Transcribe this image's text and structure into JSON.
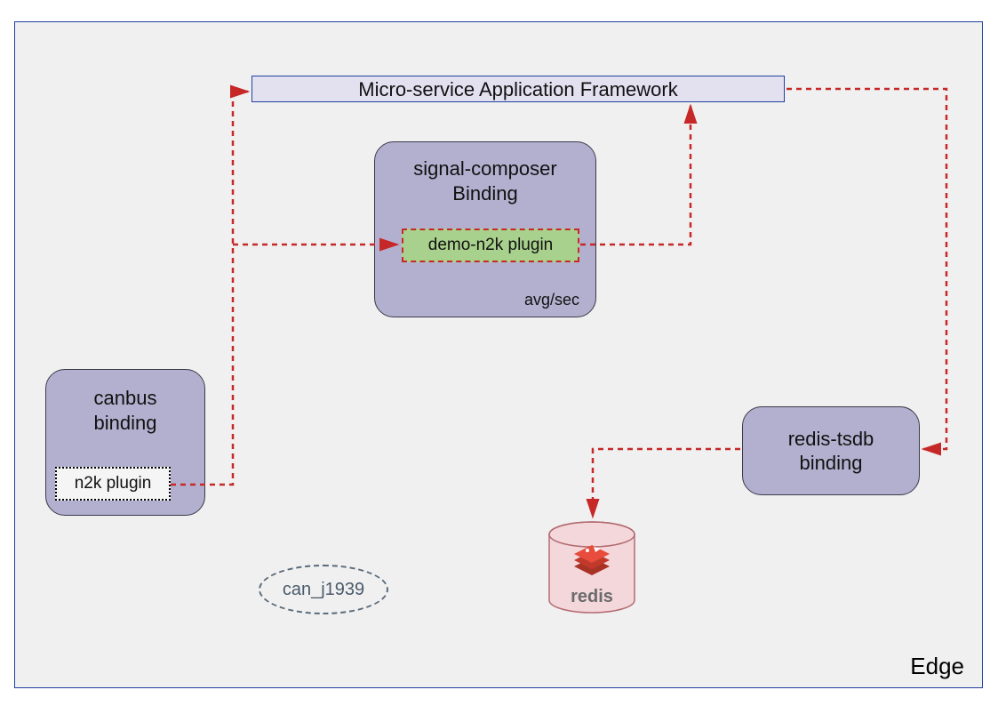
{
  "container": {
    "label": "Edge"
  },
  "framework": {
    "title": "Micro-service Application Framework"
  },
  "canbus": {
    "title_line1": "canbus",
    "title_line2": "binding",
    "plugin_label": "n2k plugin"
  },
  "signal_composer": {
    "title_line1": "signal-composer",
    "title_line2": "Binding",
    "plugin_label": "demo-n2k plugin",
    "footer": "avg/sec"
  },
  "redis_tsdb": {
    "title_line1": "redis-tsdb",
    "title_line2": "binding"
  },
  "can_j1939": {
    "label": "can_j1939"
  },
  "redis_cylinder": {
    "label": "redis"
  },
  "colors": {
    "arrow": "#c62828",
    "node_fill": "#b3b0cf",
    "node_stroke": "#3a3a4a",
    "framework_fill": "#e3e1f0",
    "framework_stroke": "#2040a0",
    "plugin_green": "#a9d18e",
    "cylinder_fill": "#f4d7da",
    "cylinder_stroke": "#b36b72"
  },
  "connections": [
    {
      "from": "canbus.n2k-plugin",
      "to": "framework",
      "style": "dashed-red"
    },
    {
      "from": "canbus.n2k-plugin",
      "to": "signal-composer.demo-plugin",
      "style": "dashed-red"
    },
    {
      "from": "signal-composer.demo-plugin",
      "to": "framework",
      "style": "dashed-red"
    },
    {
      "from": "framework",
      "to": "redis-tsdb",
      "style": "dashed-red"
    },
    {
      "from": "redis-tsdb",
      "to": "redis-cylinder",
      "style": "dashed-red"
    }
  ]
}
